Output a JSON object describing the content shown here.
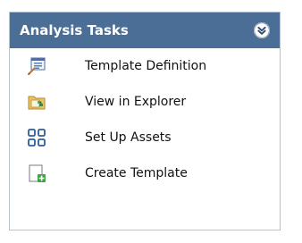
{
  "panel": {
    "title": "Analysis Tasks",
    "header_color": "#4a6e95",
    "collapse_icon": "double-chevron-up-icon"
  },
  "tasks": [
    {
      "label": "Template Definition",
      "icon": "template-definition-icon"
    },
    {
      "label": "View in Explorer",
      "icon": "view-in-explorer-icon"
    },
    {
      "label": "Set Up Assets",
      "icon": "set-up-assets-icon"
    },
    {
      "label": "Create Template",
      "icon": "create-template-icon"
    }
  ]
}
